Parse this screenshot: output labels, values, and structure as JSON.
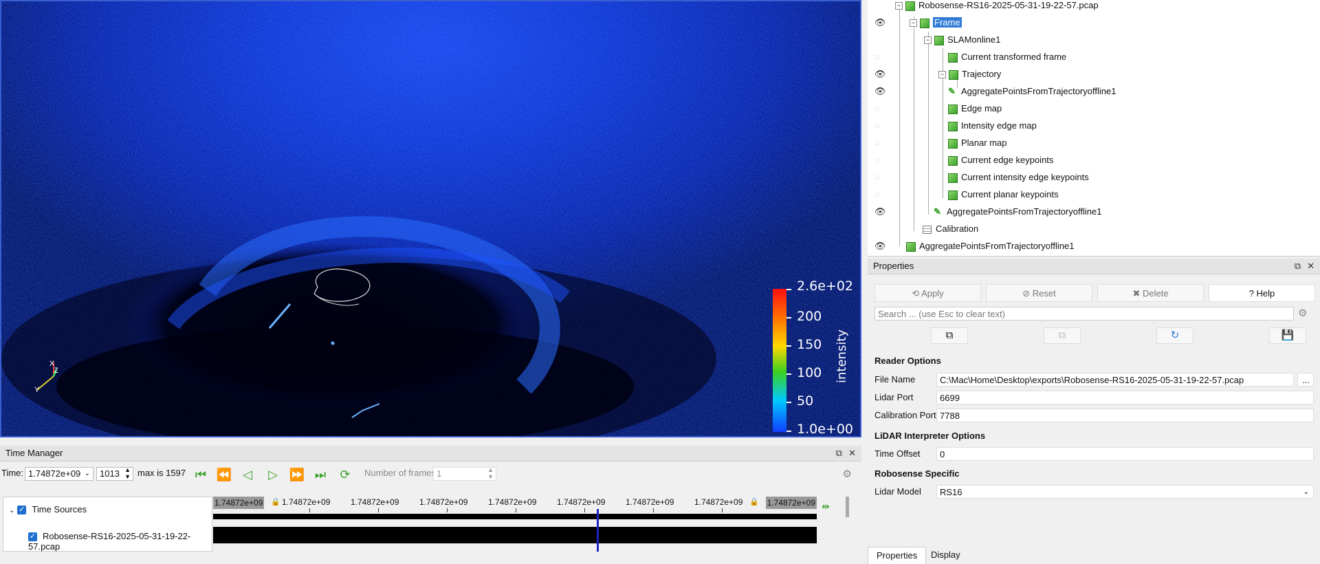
{
  "viewport": {
    "colorbar": {
      "title": "intensity",
      "labels": [
        "2.6e+02",
        "200",
        "150",
        "100",
        "50",
        "1.0e+00"
      ]
    },
    "axes": {
      "x": "X",
      "y": "Y",
      "z": "Z"
    },
    "colors": {
      "background": "#0b2fd0",
      "points": "#1a5cff",
      "border": "#3a5fd0"
    }
  },
  "pipeline": {
    "items": [
      {
        "label": "Robosense-RS16-2025-05-31-19-22-57.pcap",
        "visible": null,
        "icon": "cube-icon"
      },
      {
        "label": "Frame",
        "visible": true,
        "icon": "cube-icon",
        "selected": true
      },
      {
        "label": "SLAMonline1",
        "visible": null,
        "icon": "cube-icon"
      },
      {
        "label": "Current transformed frame",
        "visible": false,
        "icon": "cube-icon"
      },
      {
        "label": "Trajectory",
        "visible": true,
        "icon": "cube-icon"
      },
      {
        "label": "AggregatePointsFromTrajectoryoffline1",
        "visible": true,
        "icon": "filter-icon"
      },
      {
        "label": "Edge map",
        "visible": false,
        "icon": "cube-icon"
      },
      {
        "label": "Intensity edge map",
        "visible": false,
        "icon": "cube-icon"
      },
      {
        "label": "Planar map",
        "visible": false,
        "icon": "cube-icon"
      },
      {
        "label": "Current edge keypoints",
        "visible": false,
        "icon": "cube-icon"
      },
      {
        "label": "Current intensity edge keypoints",
        "visible": false,
        "icon": "cube-icon"
      },
      {
        "label": "Current planar keypoints",
        "visible": false,
        "icon": "cube-icon"
      },
      {
        "label": "AggregatePointsFromTrajectoryoffline1",
        "visible": true,
        "icon": "filter-icon"
      },
      {
        "label": "Calibration",
        "visible": null,
        "icon": "table-icon"
      },
      {
        "label": "AggregatePointsFromTrajectoryoffline1",
        "visible": true,
        "icon": "cube-icon"
      }
    ]
  },
  "properties": {
    "title": "Properties",
    "buttons": {
      "apply": "Apply",
      "reset": "Reset",
      "delete": "Delete",
      "help": "Help"
    },
    "search_placeholder": "Search ... (use Esc to clear text)",
    "reader_options": {
      "heading": "Reader Options",
      "file_name_label": "File Name",
      "file_name_value": "C:\\Mac\\Home\\Desktop\\exports\\Robosense-RS16-2025-05-31-19-22-57.pcap",
      "browse_label": "...",
      "lidar_port_label": "Lidar Port",
      "lidar_port_value": "6699",
      "calibration_port_label": "Calibration Port",
      "calibration_port_value": "7788"
    },
    "interpreter": {
      "heading": "LiDAR Interpreter Options",
      "time_offset_label": "Time Offset",
      "time_offset_value": "0"
    },
    "robosense": {
      "heading": "Robosense Specific",
      "lidar_model_label": "Lidar Model",
      "lidar_model_value": "RS16"
    },
    "tabs": [
      "Properties",
      "Display"
    ]
  },
  "time_manager": {
    "title": "Time Manager",
    "time_label": "Time:",
    "time_value": "1.74872e+09",
    "frame_index": "1013",
    "max_label": "max is 1597",
    "num_frames_label": "Number of frames",
    "num_frames_value": "1",
    "tick_labels": [
      "1.74872e+09",
      "1.74872e+09",
      "1.74872e+09",
      "1.74872e+09",
      "1.74872e+09",
      "1.74872e+09",
      "1.74872e+09"
    ],
    "start_label": "1.74872e+09",
    "end_label": "1.74872e+09",
    "sources_label": "Time Sources",
    "source_file": "Robosense-RS16-2025-05-31-19-22-57.pcap",
    "current_fraction": 0.635
  }
}
